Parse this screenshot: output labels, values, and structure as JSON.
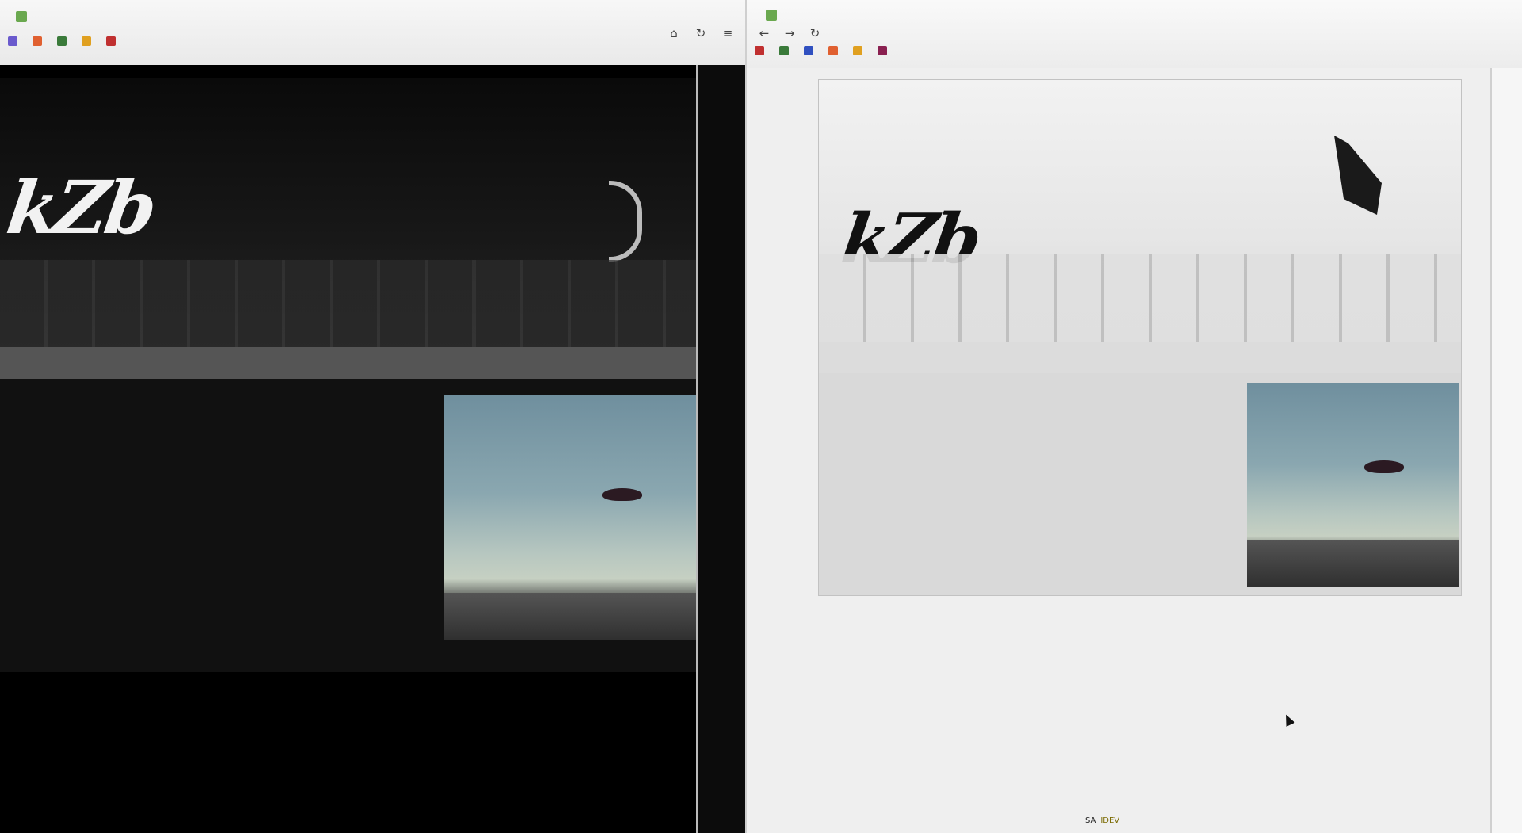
{
  "left_window": {
    "tab_title": "",
    "bookmarks": [
      {
        "label": "",
        "color": "#6a5acd"
      },
      {
        "label": "",
        "color": "#e06030"
      },
      {
        "label": "",
        "color": "#3a7a3a"
      },
      {
        "label": "",
        "color": "#e0a020"
      },
      {
        "label": "",
        "color": "#c03030"
      }
    ],
    "toolbar_icons": [
      "home-icon",
      "refresh-icon",
      "menu-icon"
    ],
    "hero_logo": "kZb",
    "nav": {
      "items": [
        "",
        "",
        "",
        ""
      ],
      "right": ""
    },
    "intro": {
      "heading": "",
      "paragraphs": [
        "",
        ""
      ]
    },
    "photo_caption": ""
  },
  "right_window": {
    "tab_title": "",
    "bookmarks": [
      {
        "label": "",
        "color": "#c03030"
      },
      {
        "label": "",
        "color": "#3a7a3a"
      },
      {
        "label": "",
        "color": "#3050c0"
      },
      {
        "label": "",
        "color": "#e06030"
      },
      {
        "label": "",
        "color": "#e0a020"
      },
      {
        "label": "",
        "color": "#8a2050"
      }
    ],
    "toolbar_icons": [
      "back-icon",
      "forward-icon",
      "reload-icon"
    ],
    "hero_logo": "kZb",
    "nav": {
      "items": [
        "",
        "",
        "",
        ""
      ],
      "right": ""
    },
    "intro": {
      "heading": "",
      "paragraphs": [
        "",
        ""
      ]
    },
    "photo_caption": "",
    "footer_badge": {
      "left": "ISA",
      "right": "IDEV"
    }
  }
}
